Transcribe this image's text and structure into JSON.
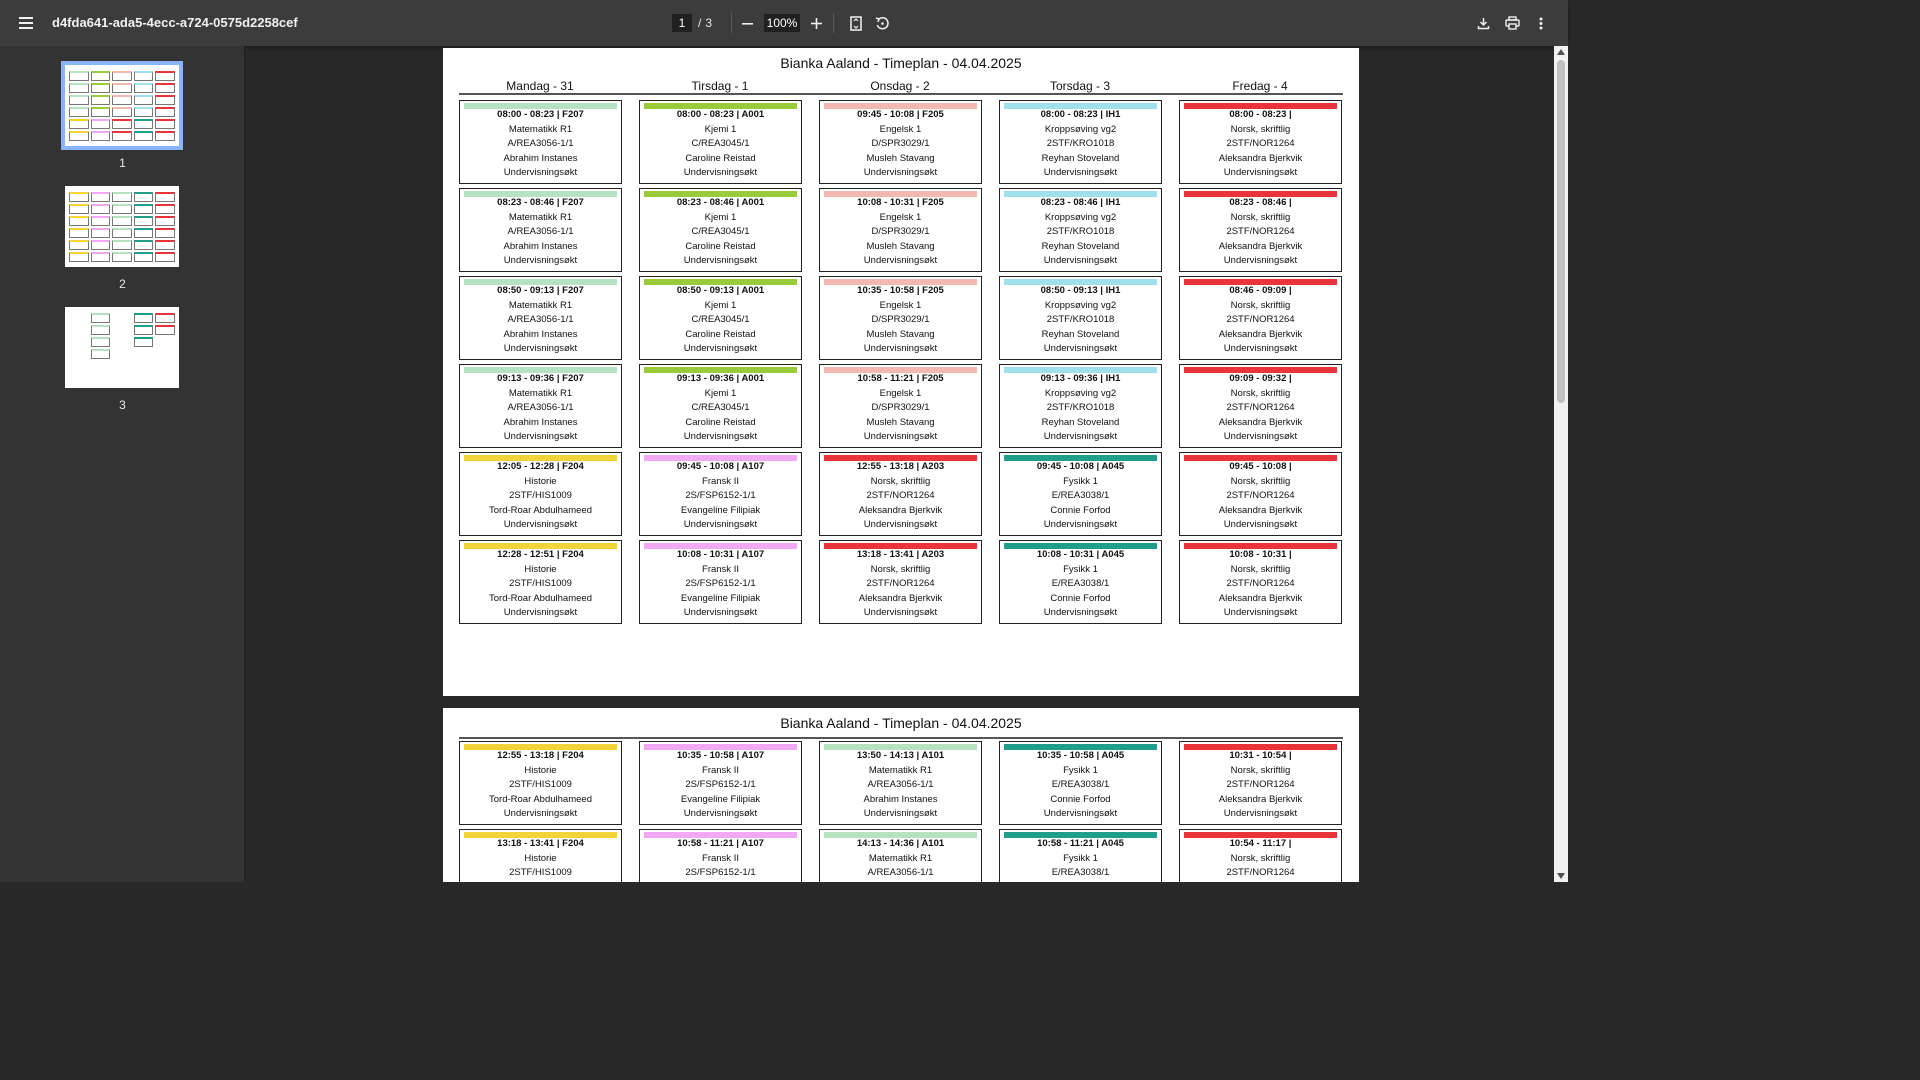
{
  "toolbar": {
    "doc_title": "d4fda641-ada5-4ecc-a724-0575d2258cef",
    "page_current": "1",
    "page_sep": "/",
    "page_total": "3",
    "zoom": "100%"
  },
  "sidebar": {
    "thumbnails": [
      {
        "label": "1"
      },
      {
        "label": "2"
      },
      {
        "label": "3"
      }
    ]
  },
  "colors": {
    "math": "#b7e2c2",
    "chem": "#9acb3a",
    "english": "#f4b8b2",
    "pe": "#9fe0ee",
    "norsk": "#e8343a",
    "history": "#f1d33a",
    "french": "#f2a8f2",
    "physics": "#1f9e8c"
  },
  "pages": [
    {
      "title": "Bianka Aaland - Timeplan - 04.04.2025",
      "days": [
        "Mandag - 31",
        "Tirsdag - 1",
        "Onsdag - 2",
        "Torsdag - 3",
        "Fredag - 4"
      ],
      "columns": [
        [
          {
            "color": "#b7e2c2",
            "lines": [
              "08:00 - 08:23 | F207",
              "Matematikk R1",
              "A/REA3056-1/1",
              "Abrahim Instanes",
              "Undervisningsøkt"
            ]
          },
          {
            "color": "#b7e2c2",
            "lines": [
              "08:23 - 08:46 | F207",
              "Matematikk R1",
              "A/REA3056-1/1",
              "Abrahim Instanes",
              "Undervisningsøkt"
            ]
          },
          {
            "color": "#b7e2c2",
            "lines": [
              "08:50 - 09:13 | F207",
              "Matematikk R1",
              "A/REA3056-1/1",
              "Abrahim Instanes",
              "Undervisningsøkt"
            ]
          },
          {
            "color": "#b7e2c2",
            "lines": [
              "09:13 - 09:36 | F207",
              "Matematikk R1",
              "A/REA3056-1/1",
              "Abrahim Instanes",
              "Undervisningsøkt"
            ]
          },
          {
            "color": "#f1d33a",
            "lines": [
              "12:05 - 12:28 | F204",
              "Historie",
              "2STF/HIS1009",
              "Tord-Roar Abdulhameed",
              "Undervisningsøkt"
            ]
          },
          {
            "color": "#f1d33a",
            "lines": [
              "12:28 - 12:51 | F204",
              "Historie",
              "2STF/HIS1009",
              "Tord-Roar Abdulhameed",
              "Undervisningsøkt"
            ]
          }
        ],
        [
          {
            "color": "#9acb3a",
            "lines": [
              "08:00 - 08:23 | A001",
              "Kjemi 1",
              "C/REA3045/1",
              "Caroline Reistad",
              "Undervisningsøkt"
            ]
          },
          {
            "color": "#9acb3a",
            "lines": [
              "08:23 - 08:46 | A001",
              "Kjemi 1",
              "C/REA3045/1",
              "Caroline Reistad",
              "Undervisningsøkt"
            ]
          },
          {
            "color": "#9acb3a",
            "lines": [
              "08:50 - 09:13 | A001",
              "Kjemi 1",
              "C/REA3045/1",
              "Caroline Reistad",
              "Undervisningsøkt"
            ]
          },
          {
            "color": "#9acb3a",
            "lines": [
              "09:13 - 09:36 | A001",
              "Kjemi 1",
              "C/REA3045/1",
              "Caroline Reistad",
              "Undervisningsøkt"
            ]
          },
          {
            "color": "#f2a8f2",
            "lines": [
              "09:45 - 10:08 | A107",
              "Fransk II",
              "2S/FSP6152-1/1",
              "Evangeline Filipiak",
              "Undervisningsøkt"
            ]
          },
          {
            "color": "#f2a8f2",
            "lines": [
              "10:08 - 10:31 | A107",
              "Fransk II",
              "2S/FSP6152-1/1",
              "Evangeline Filipiak",
              "Undervisningsøkt"
            ]
          }
        ],
        [
          {
            "color": "#f4b8b2",
            "lines": [
              "09:45 - 10:08 | F205",
              "Engelsk 1",
              "D/SPR3029/1",
              "Musleh Stavang",
              "Undervisningsøkt"
            ]
          },
          {
            "color": "#f4b8b2",
            "lines": [
              "10:08 - 10:31 | F205",
              "Engelsk 1",
              "D/SPR3029/1",
              "Musleh Stavang",
              "Undervisningsøkt"
            ]
          },
          {
            "color": "#f4b8b2",
            "lines": [
              "10:35 - 10:58 | F205",
              "Engelsk 1",
              "D/SPR3029/1",
              "Musleh Stavang",
              "Undervisningsøkt"
            ]
          },
          {
            "color": "#f4b8b2",
            "lines": [
              "10:58 - 11:21 | F205",
              "Engelsk 1",
              "D/SPR3029/1",
              "Musleh Stavang",
              "Undervisningsøkt"
            ]
          },
          {
            "color": "#e8343a",
            "lines": [
              "12:55 - 13:18 | A203",
              "Norsk, skriftlig",
              "2STF/NOR1264",
              "Aleksandra Bjerkvik",
              "Undervisningsøkt"
            ]
          },
          {
            "color": "#e8343a",
            "lines": [
              "13:18 - 13:41 | A203",
              "Norsk, skriftlig",
              "2STF/NOR1264",
              "Aleksandra Bjerkvik",
              "Undervisningsøkt"
            ]
          }
        ],
        [
          {
            "color": "#9fe0ee",
            "lines": [
              "08:00 - 08:23 | IH1",
              "Kroppsøving vg2",
              "2STF/KRO1018",
              "Reyhan Stoveland",
              "Undervisningsøkt"
            ]
          },
          {
            "color": "#9fe0ee",
            "lines": [
              "08:23 - 08:46 | IH1",
              "Kroppsøving vg2",
              "2STF/KRO1018",
              "Reyhan Stoveland",
              "Undervisningsøkt"
            ]
          },
          {
            "color": "#9fe0ee",
            "lines": [
              "08:50 - 09:13 | IH1",
              "Kroppsøving vg2",
              "2STF/KRO1018",
              "Reyhan Stoveland",
              "Undervisningsøkt"
            ]
          },
          {
            "color": "#9fe0ee",
            "lines": [
              "09:13 - 09:36 | IH1",
              "Kroppsøving vg2",
              "2STF/KRO1018",
              "Reyhan Stoveland",
              "Undervisningsøkt"
            ]
          },
          {
            "color": "#1f9e8c",
            "lines": [
              "09:45 - 10:08 | A045",
              "Fysikk 1",
              "E/REA3038/1",
              "Connie Forfod",
              "Undervisningsøkt"
            ]
          },
          {
            "color": "#1f9e8c",
            "lines": [
              "10:08 - 10:31 | A045",
              "Fysikk 1",
              "E/REA3038/1",
              "Connie Forfod",
              "Undervisningsøkt"
            ]
          }
        ],
        [
          {
            "color": "#e8343a",
            "lines": [
              "08:00 - 08:23 |",
              "Norsk, skriftlig",
              "2STF/NOR1264",
              "Aleksandra Bjerkvik",
              "Undervisningsøkt"
            ]
          },
          {
            "color": "#e8343a",
            "lines": [
              "08:23 - 08:46 |",
              "Norsk, skriftlig",
              "2STF/NOR1264",
              "Aleksandra Bjerkvik",
              "Undervisningsøkt"
            ]
          },
          {
            "color": "#e8343a",
            "lines": [
              "08:46 - 09:09 |",
              "Norsk, skriftlig",
              "2STF/NOR1264",
              "Aleksandra Bjerkvik",
              "Undervisningsøkt"
            ]
          },
          {
            "color": "#e8343a",
            "lines": [
              "09:09 - 09:32 |",
              "Norsk, skriftlig",
              "2STF/NOR1264",
              "Aleksandra Bjerkvik",
              "Undervisningsøkt"
            ]
          },
          {
            "color": "#e8343a",
            "lines": [
              "09:45 - 10:08 |",
              "Norsk, skriftlig",
              "2STF/NOR1264",
              "Aleksandra Bjerkvik",
              "Undervisningsøkt"
            ]
          },
          {
            "color": "#e8343a",
            "lines": [
              "10:08 - 10:31 |",
              "Norsk, skriftlig",
              "2STF/NOR1264",
              "Aleksandra Bjerkvik",
              "Undervisningsøkt"
            ]
          }
        ]
      ]
    },
    {
      "title": "Bianka Aaland - Timeplan - 04.04.2025",
      "days": [],
      "columns": [
        [
          {
            "color": "#f1d33a",
            "lines": [
              "12:55 - 13:18 | F204",
              "Historie",
              "2STF/HIS1009",
              "Tord-Roar Abdulhameed",
              "Undervisningsøkt"
            ]
          },
          {
            "color": "#f1d33a",
            "lines": [
              "13:18 - 13:41 | F204",
              "Historie",
              "2STF/HIS1009"
            ]
          }
        ],
        [
          {
            "color": "#f2a8f2",
            "lines": [
              "10:35 - 10:58 | A107",
              "Fransk II",
              "2S/FSP6152-1/1",
              "Evangeline Filipiak",
              "Undervisningsøkt"
            ]
          },
          {
            "color": "#f2a8f2",
            "lines": [
              "10:58 - 11:21 | A107",
              "Fransk II",
              "2S/FSP6152-1/1"
            ]
          }
        ],
        [
          {
            "color": "#b7e2c2",
            "lines": [
              "13:50 - 14:13 | A101",
              "Matematikk R1",
              "A/REA3056-1/1",
              "Abrahim Instanes",
              "Undervisningsøkt"
            ]
          },
          {
            "color": "#b7e2c2",
            "lines": [
              "14:13 - 14:36 | A101",
              "Matematikk R1",
              "A/REA3056-1/1"
            ]
          }
        ],
        [
          {
            "color": "#1f9e8c",
            "lines": [
              "10:35 - 10:58 | A045",
              "Fysikk 1",
              "E/REA3038/1",
              "Connie Forfod",
              "Undervisningsøkt"
            ]
          },
          {
            "color": "#1f9e8c",
            "lines": [
              "10:58 - 11:21 | A045",
              "Fysikk 1",
              "E/REA3038/1"
            ]
          }
        ],
        [
          {
            "color": "#e8343a",
            "lines": [
              "10:31 - 10:54 |",
              "Norsk, skriftlig",
              "2STF/NOR1264",
              "Aleksandra Bjerkvik",
              "Undervisningsøkt"
            ]
          },
          {
            "color": "#e8343a",
            "lines": [
              "10:54 - 11:17 |",
              "Norsk, skriftlig",
              "2STF/NOR1264"
            ]
          }
        ]
      ]
    }
  ]
}
